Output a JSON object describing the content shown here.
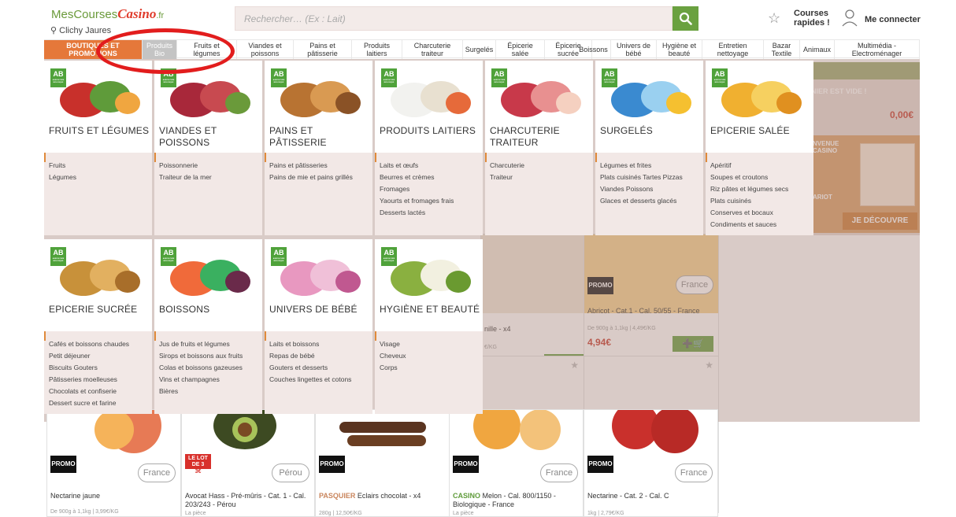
{
  "header": {
    "logo_mes": "MesCourses",
    "logo_casino": "Casino",
    "logo_fr": ".fr",
    "location": "Clichy Jaures",
    "search_placeholder": "Rechercher… (Ex : Lait)",
    "quick_line1": "Courses",
    "quick_line2": "rapides !",
    "login": "Me connecter"
  },
  "nav": [
    {
      "l1": "BOUTIQUES ET",
      "l2": "PROMOTIONS"
    },
    {
      "l1": "Produits",
      "l2": "Bio"
    },
    {
      "l1": "Fruits et",
      "l2": "légumes"
    },
    {
      "l1": "Viandes et",
      "l2": "poissons"
    },
    {
      "l1": "Pains et",
      "l2": "pâtisserie"
    },
    {
      "l1": "Produits",
      "l2": "laitiers"
    },
    {
      "l1": "Charcuterie",
      "l2": "traiteur"
    },
    {
      "l1": "Surgelés",
      "l2": ""
    },
    {
      "l1": "Épicerie",
      "l2": "salée"
    },
    {
      "l1": "Épicerie",
      "l2": "sucrée"
    },
    {
      "l1": "Boissons",
      "l2": ""
    },
    {
      "l1": "Univers de",
      "l2": "bébé"
    },
    {
      "l1": "Hygiène et",
      "l2": "beauté"
    },
    {
      "l1": "Entretien",
      "l2": "nettoyage"
    },
    {
      "l1": "Bazar",
      "l2": "Textile"
    },
    {
      "l1": "Animaux",
      "l2": ""
    },
    {
      "l1": "Multimédia -",
      "l2": "Electroménager"
    }
  ],
  "cart": {
    "empty": "NIER EST VIDE !",
    "total": "0,00€",
    "banner_text_1": "NVENUE",
    "banner_text_2": "CASINO",
    "banner_text_3": "ARIOT",
    "cta": "JE DÉCOUVRE"
  },
  "badge_ab": "AB",
  "badge_ab_small": "AGRICULTURE BIOLOGIQUE",
  "menu": [
    {
      "t1": "FRUITS ET LÉGUMES",
      "t2": "",
      "items": [
        "Fruits",
        "Légumes"
      ]
    },
    {
      "t1": "VIANDES ET",
      "t2": "POISSONS",
      "items": [
        "Poissonnerie",
        "Traiteur de la mer"
      ]
    },
    {
      "t1": "PAINS ET PÂTISSERIE",
      "t2": "",
      "items": [
        "Pains et pâtisseries",
        "Pains de mie et pains grillés"
      ]
    },
    {
      "t1": "PRODUITS LAITIERS",
      "t2": "",
      "items": [
        "Laits et œufs",
        "Beurres et crèmes",
        "Fromages",
        "Yaourts et fromages frais",
        "Desserts lactés"
      ]
    },
    {
      "t1": "CHARCUTERIE",
      "t2": "TRAITEUR",
      "items": [
        "Charcuterie",
        "Traiteur"
      ]
    },
    {
      "t1": "SURGELÉS",
      "t2": "",
      "items": [
        "Légumes et frites",
        "Plats cuisinés Tartes Pizzas",
        "Viandes Poissons",
        "Glaces et desserts glacés"
      ]
    },
    {
      "t1": "EPICERIE SALÉE",
      "t2": "",
      "items": [
        "Apéritif",
        "Soupes et croutons",
        "Riz pâtes et légumes secs",
        "Plats cuisinés",
        "Conserves et bocaux",
        "Condiments et sauces"
      ]
    },
    {
      "t1": "EPICERIE SUCRÉE",
      "t2": "",
      "items": [
        "Cafés et boissons chaudes",
        "Petit déjeuner",
        "Biscuits Gouters",
        "Pâtisseries moelleuses",
        "Chocolats et confiserie",
        "Dessert sucre et farine"
      ]
    },
    {
      "t1": "BOISSONS",
      "t2": "",
      "items": [
        "Jus de fruits et légumes",
        "Sirops et boissons aux fruits",
        "Colas et boissons gazeuses",
        "Vins et champagnes",
        "Bières"
      ]
    },
    {
      "t1": "UNIVERS DE BÉBÉ",
      "t2": "",
      "items": [
        "Laits et boissons",
        "Repas de bébé",
        "Gouters et desserts",
        "Couches lingettes et cotons"
      ]
    },
    {
      "t1": "HYGIÈNE ET BEAUTÉ",
      "t2": "",
      "items": [
        "Visage",
        "Cheveux",
        "Corps"
      ]
    }
  ],
  "products": {
    "p_vanille": {
      "name": "nille - x4",
      "sub": "€/KG"
    },
    "p_abricot": {
      "badge": "PROMO",
      "origin": "France",
      "name": "Abricot - Cat.1 - Cal. 50/55 - France",
      "sub": "De 900g à 1,1kg | 4,49€/KG",
      "price": "4,94€",
      "add": "+🛒"
    },
    "p_nectarine": {
      "badge": "PROMO",
      "origin": "France",
      "name": "Nectarine jaune",
      "sub": "De 900g à 1,1kg | 3,99€/KG"
    },
    "p_avocat": {
      "lot1": "LE LOT",
      "lot2": "DE 3",
      "lot3": "3€",
      "origin": "Pérou",
      "name": "Avocat Hass - Pré-mûris - Cat. 1 - Cal. 203/243 - Pérou",
      "sub": "La pièce"
    },
    "p_eclairs": {
      "badge": "PROMO",
      "brand": "PASQUIER",
      "name": " Eclairs chocolat - x4",
      "sub": "280g | 12,50€/KG"
    },
    "p_melon": {
      "badge": "PROMO",
      "origin": "France",
      "brand": "CASINO",
      "name": " Melon - Cal. 800/1150 - Biologique - France",
      "sub": "La pièce"
    },
    "p_nect2": {
      "badge": "PROMO",
      "origin": "France",
      "name": "Nectarine - Cat. 2 - Cal. C",
      "sub": "1kg | 2,79€/KG"
    }
  },
  "colors": {
    "accent_green": "#6aa140",
    "promo_orange": "#e5783a",
    "price_red": "#c43326",
    "circle_red": "#e21d1d"
  }
}
